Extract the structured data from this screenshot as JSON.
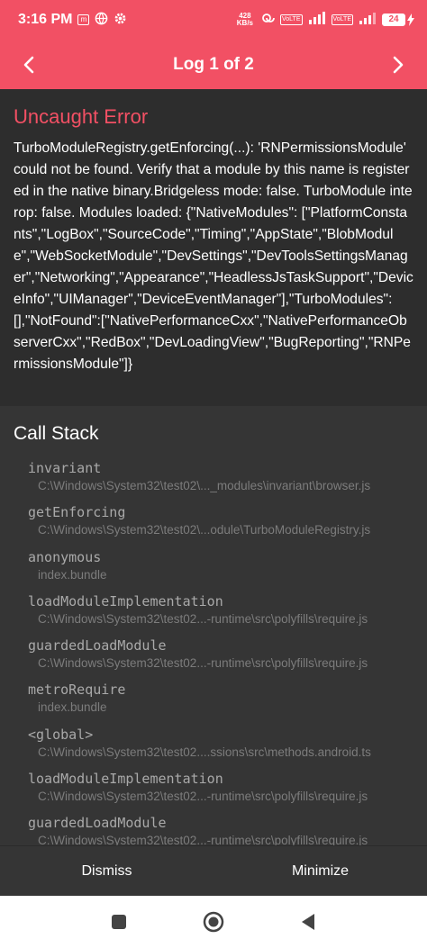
{
  "status_bar": {
    "time": "3:16 PM",
    "net_speed_value": "428",
    "net_speed_unit": "KB/s",
    "battery_level": "24",
    "colors": {
      "bar": "#F25064",
      "text": "#FFFFFF"
    },
    "icons": [
      "message-icon",
      "globe-icon",
      "settings-icon",
      "hotspot-icon",
      "volte-icon",
      "signal-icon",
      "wifi-icon",
      "battery-icon",
      "charging-icon"
    ]
  },
  "header": {
    "title": "Log 1 of 2",
    "prev_icon": "chevron-left-icon",
    "next_icon": "chevron-right-icon"
  },
  "error": {
    "title": "Uncaught Error",
    "message": "TurboModuleRegistry.getEnforcing(...): 'RNPermissionsModule' could not be found. Verify that a module by this name is registered in the native binary.Bridgeless mode: false. TurboModule interop: false. Modules loaded: {\"NativeModules\": [\"PlatformConstants\",\"LogBox\",\"SourceCode\",\"Timing\",\"AppState\",\"BlobModule\",\"WebSocketModule\",\"DevSettings\",\"DevToolsSettingsManager\",\"Networking\",\"Appearance\",\"HeadlessJsTaskSupport\",\"DeviceInfo\",\"UIManager\",\"DeviceEventManager\"],\"TurboModules\":[],\"NotFound\":[\"NativePerformanceCxx\",\"NativePerformanceObserverCxx\",\"RedBox\",\"DevLoadingView\",\"BugReporting\",\"RNPermissionsModule\"]}",
    "accent_color": "#F25064"
  },
  "call_stack": {
    "title": "Call Stack",
    "frames": [
      {
        "name": "invariant",
        "file": "C:\\Windows\\System32\\test02\\..._modules\\invariant\\browser.js"
      },
      {
        "name": "getEnforcing",
        "file": "C:\\Windows\\System32\\test02\\...odule\\TurboModuleRegistry.js"
      },
      {
        "name": "anonymous",
        "file": "index.bundle"
      },
      {
        "name": "loadModuleImplementation",
        "file": "C:\\Windows\\System32\\test02...-runtime\\src\\polyfills\\require.js"
      },
      {
        "name": "guardedLoadModule",
        "file": "C:\\Windows\\System32\\test02...-runtime\\src\\polyfills\\require.js"
      },
      {
        "name": "metroRequire",
        "file": "index.bundle"
      },
      {
        "name": "<global>",
        "file": "C:\\Windows\\System32\\test02....ssions\\src\\methods.android.ts"
      },
      {
        "name": "loadModuleImplementation",
        "file": "C:\\Windows\\System32\\test02...-runtime\\src\\polyfills\\require.js"
      },
      {
        "name": "guardedLoadModule",
        "file": "C:\\Windows\\System32\\test02...-runtime\\src\\polyfills\\require.js"
      }
    ]
  },
  "footer": {
    "dismiss_label": "Dismiss",
    "minimize_label": "Minimize"
  },
  "system_nav": {
    "recents_icon": "square-recents-icon",
    "home_icon": "circle-home-icon",
    "back_icon": "triangle-back-icon"
  }
}
